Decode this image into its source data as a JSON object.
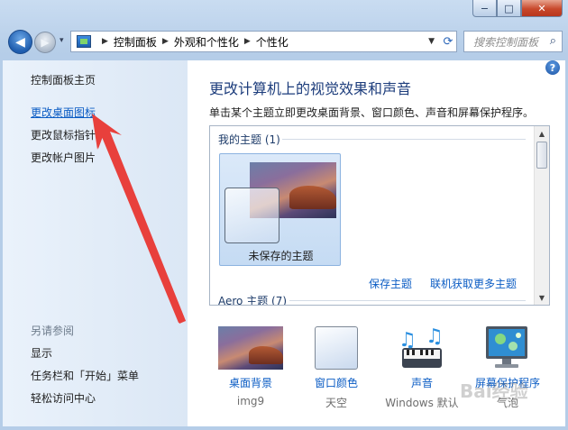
{
  "window": {
    "minimize_glyph": "−",
    "maximize_glyph": "□",
    "close_glyph": "✕"
  },
  "nav": {
    "back_glyph": "◀",
    "forward_glyph": "▶",
    "history_glyph": "▾",
    "breadcrumb": [
      "控制面板",
      "外观和个性化",
      "个性化"
    ],
    "separator": "▶",
    "address_dropdown_glyph": "▼",
    "refresh_glyph": "⟳",
    "search_placeholder": "搜索控制面板",
    "search_icon": "search-icon"
  },
  "sidebar": {
    "items": [
      {
        "label": "控制面板主页"
      },
      {
        "label": "更改桌面图标"
      },
      {
        "label": "更改鼠标指针"
      },
      {
        "label": "更改帐户图片"
      }
    ],
    "see_also_title": "另请参阅",
    "see_also": [
      {
        "label": "显示"
      },
      {
        "label": "任务栏和「开始」菜单"
      },
      {
        "label": "轻松访问中心"
      }
    ]
  },
  "main": {
    "help_glyph": "?",
    "title": "更改计算机上的视觉效果和声音",
    "description": "单击某个主题立即更改桌面背景、窗口颜色、声音和屏幕保护程序。",
    "my_themes_label": "我的主题 (1)",
    "unsaved_theme_label": "未保存的主题",
    "save_theme_link": "保存主题",
    "more_themes_link": "联机获取更多主题",
    "aero_themes_label": "Aero 主题 (7)",
    "scroll_up_glyph": "▲",
    "scroll_down_glyph": "▼"
  },
  "bottom": {
    "items": [
      {
        "label": "桌面背景",
        "sub": "img9"
      },
      {
        "label": "窗口颜色",
        "sub": "天空"
      },
      {
        "label": "声音",
        "sub": "Windows 默认"
      },
      {
        "label": "屏幕保护程序",
        "sub": "气泡"
      }
    ]
  },
  "watermark": "Bai经验",
  "colors": {
    "link": "#0b5cc4",
    "title": "#1d3d7c",
    "annotation_arrow": "#e8403c"
  }
}
